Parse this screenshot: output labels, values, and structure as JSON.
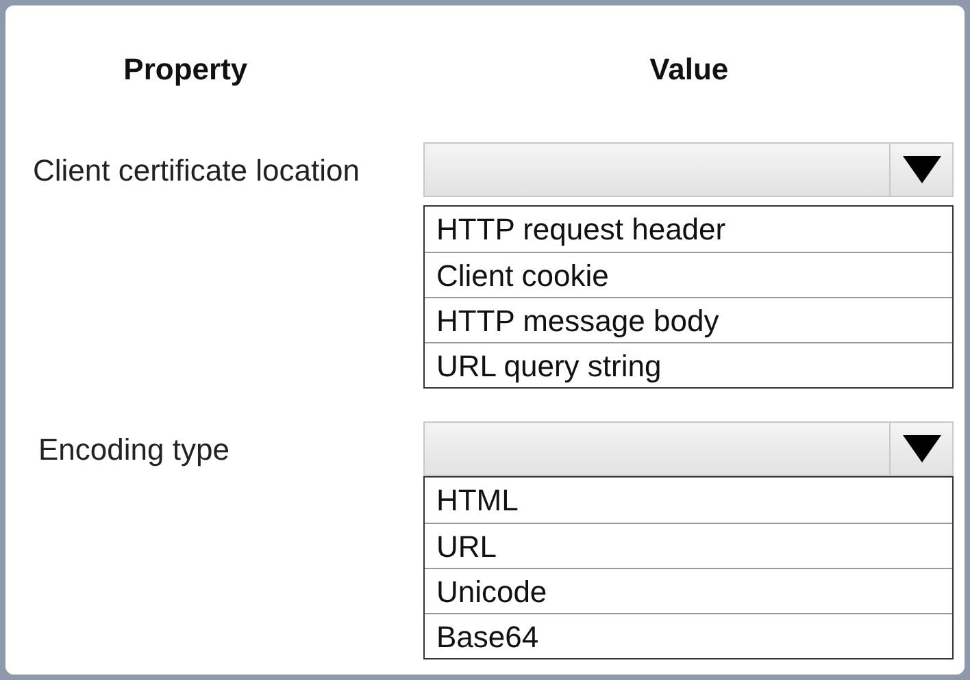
{
  "headers": [
    "Property",
    "Value"
  ],
  "fields": [
    {
      "label": "Client certificate location",
      "options": [
        "HTTP request header",
        "Client cookie",
        "HTTP message body",
        "URL query string"
      ]
    },
    {
      "label": "Encoding type",
      "options": [
        "HTML",
        "URL",
        "Unicode",
        "Base64"
      ]
    }
  ]
}
